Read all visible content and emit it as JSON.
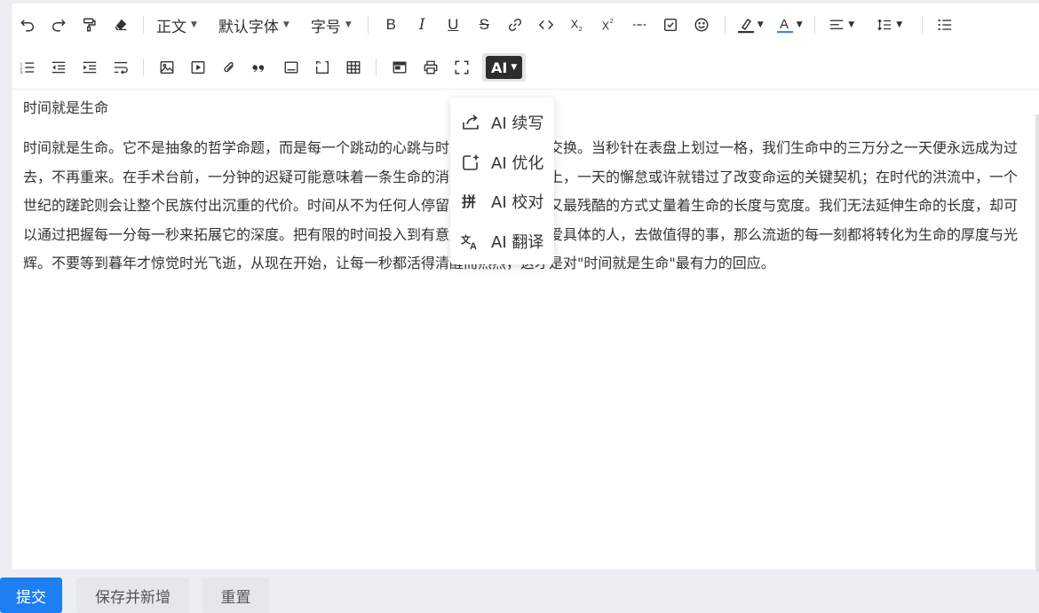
{
  "toolbar": {
    "paragraph_style": "正文",
    "font_family": "默认字体",
    "font_size": "字号",
    "bold": "B",
    "italic": "I",
    "underline": "U",
    "strike": "S",
    "ai_label": "AI"
  },
  "ai_menu": {
    "items": [
      {
        "label": "AI 续写",
        "icon": "continue-write-icon"
      },
      {
        "label": "AI 优化",
        "icon": "optimize-icon"
      },
      {
        "label": "AI 校对",
        "icon": "proofread-icon"
      },
      {
        "label": "AI 翻译",
        "icon": "translate-icon"
      }
    ]
  },
  "content": {
    "title_line": "时间就是生命",
    "paragraph": "时间就是生命。它不是抽象的哲学命题，而是每一个跳动的心跳与时间最真实的等价交换。当秒针在表盘上划过一格，我们生命中的三万分之一天便永远成为过去，不再重来。在手术台前，一分钟的迟疑可能意味着一条生命的消逝；在求知的路上，一天的懈怠或许就错过了改变命运的关键契机；在时代的洪流中，一个世纪的蹉跎则会让整个民族付出沉重的代价。时间从不为任何人停留，它以最公正却又最残酷的方式丈量着生命的长度与宽度。我们无法延伸生命的长度，却可以通过把握每一分每一秒来拓展它的深度。把有限的时间投入到有意义的事业中，去爱具体的人，去做值得的事，那么流逝的每一刻都将转化为生命的厚度与光辉。不要等到暮年才惊觉时光飞逝，从现在开始，让每一秒都活得清醒而热烈，这才是对\"时间就是生命\"最有力的回应。"
  },
  "footer": {
    "submit": "提交",
    "save_new": "保存并新增",
    "reset": "重置"
  },
  "colors": {
    "primary": "#1e7ef3",
    "highlight_bar": "#333333",
    "font_color_bar": "#3b8ad9"
  }
}
